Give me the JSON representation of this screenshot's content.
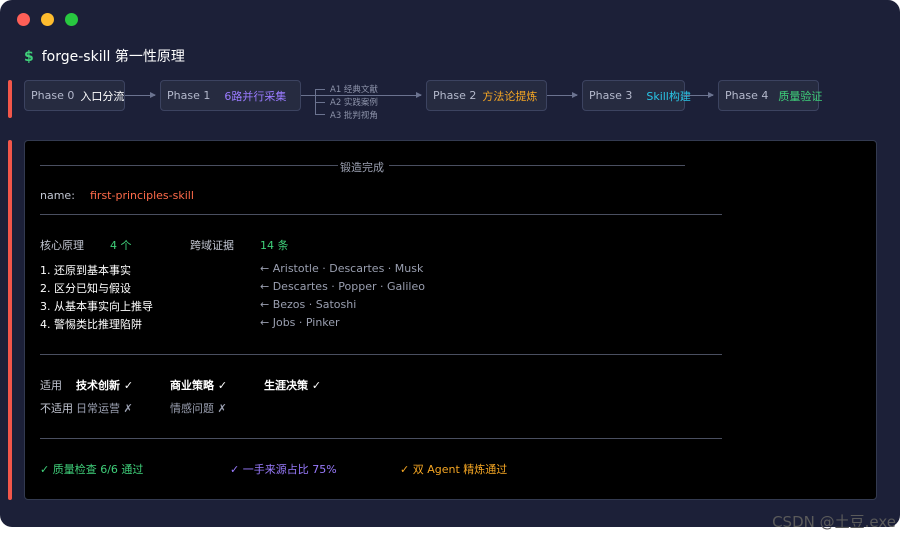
{
  "window": {
    "title_prompt": "$",
    "title": "forge-skill 第一性原理"
  },
  "pipeline": {
    "phases": [
      {
        "num": "Phase 0",
        "name": "入口分流",
        "color": "#ffffff"
      },
      {
        "num": "Phase 1",
        "name": "6路并行采集",
        "color": "#9a7bff"
      },
      {
        "num": "Phase 2",
        "name": "方法论提炼",
        "color": "#f5a623"
      },
      {
        "num": "Phase 3",
        "name": "Skill构建",
        "color": "#29c5e6"
      },
      {
        "num": "Phase 4",
        "name": "质量验证",
        "color": "#3fd07a"
      }
    ],
    "branches": [
      "A1 经典文献",
      "A2 实践案例",
      "A3 批判视角"
    ]
  },
  "panel": {
    "header": "锻造完成",
    "name_label": "name:",
    "name_value": "first-principles-skill",
    "core_label": "核心原理",
    "core_count": "4 个",
    "evidence_label": "跨域证据",
    "evidence_count": "14 条",
    "principles": [
      {
        "text": "1. 还原到基本事实",
        "sources": "← Aristotle · Descartes · Musk"
      },
      {
        "text": "2. 区分已知与假设",
        "sources": "← Descartes · Popper · Galileo"
      },
      {
        "text": "3. 从基本事实向上推导",
        "sources": "← Bezos · Satoshi"
      },
      {
        "text": "4. 警惕类比推理陷阱",
        "sources": "← Jobs · Pinker"
      }
    ],
    "applicable_label": "适用",
    "applicable": [
      "技术创新 ✓",
      "商业策略 ✓",
      "生涯决策 ✓"
    ],
    "not_applicable_label": "不适用",
    "not_applicable": [
      "日常运营 ✗",
      "情感问题 ✗"
    ],
    "checks": [
      {
        "text": "✓ 质量检查 6/6 通过",
        "color": "#3fd07a"
      },
      {
        "text": "✓ 一手来源占比 75%",
        "color": "#9a7bff"
      },
      {
        "text": "✓ 双 Agent 精炼通过",
        "color": "#f5a623"
      }
    ]
  },
  "watermark": "CSDN @土豆.exe"
}
